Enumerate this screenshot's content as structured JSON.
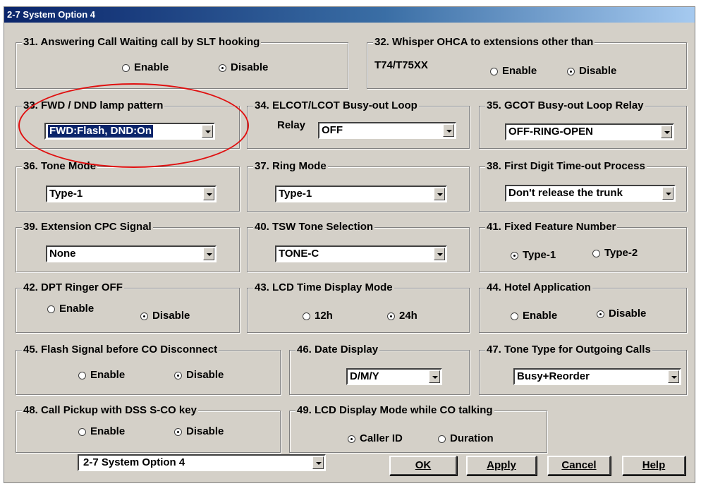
{
  "title": "2-7 System Option 4",
  "g31": {
    "legend": "31. Answering Call Waiting call by SLT hooking",
    "opt1": "Enable",
    "opt2": "Disable"
  },
  "g32": {
    "legend": "32. Whisper OHCA to extensions other than",
    "sub": "T74/T75XX",
    "opt1": "Enable",
    "opt2": "Disable"
  },
  "g33": {
    "legend": "33. FWD / DND lamp pattern",
    "value": "FWD:Flash, DND:On"
  },
  "g34": {
    "legend": "34. ELCOT/LCOT Busy-out Loop",
    "prefix": "Relay",
    "value": "OFF"
  },
  "g35": {
    "legend": "35. GCOT Busy-out Loop Relay",
    "value": "OFF-RING-OPEN"
  },
  "g36": {
    "legend": "36. Tone Mode",
    "value": "Type-1"
  },
  "g37": {
    "legend": "37. Ring Mode",
    "value": "Type-1"
  },
  "g38": {
    "legend": "38. First Digit Time-out Process",
    "value": "Don't release the trunk"
  },
  "g39": {
    "legend": "39. Extension CPC Signal",
    "value": "None"
  },
  "g40": {
    "legend": "40. TSW Tone Selection",
    "value": "TONE-C"
  },
  "g41": {
    "legend": "41. Fixed Feature Number",
    "opt1": "Type-1",
    "opt2": "Type-2"
  },
  "g42": {
    "legend": "42. DPT Ringer OFF",
    "opt1": "Enable",
    "opt2": "Disable"
  },
  "g43": {
    "legend": "43. LCD Time Display Mode",
    "opt1": "12h",
    "opt2": "24h"
  },
  "g44": {
    "legend": "44. Hotel Application",
    "opt1": "Enable",
    "opt2": "Disable"
  },
  "g45": {
    "legend": "45. Flash Signal before CO Disconnect",
    "opt1": "Enable",
    "opt2": "Disable"
  },
  "g46": {
    "legend": "46. Date Display",
    "value": "D/M/Y"
  },
  "g47": {
    "legend": "47. Tone Type for Outgoing Calls",
    "value": "Busy+Reorder"
  },
  "g48": {
    "legend": "48. Call Pickup with DSS S-CO key",
    "opt1": "Enable",
    "opt2": "Disable"
  },
  "g49": {
    "legend": "49. LCD Display Mode while CO talking",
    "opt1": "Caller ID",
    "opt2": "Duration"
  },
  "footer": {
    "page_select": "2-7 System Option 4",
    "ok": "OK",
    "apply": "Apply",
    "cancel": "Cancel",
    "help": "Help"
  },
  "annotation": {
    "color": "#e01010"
  }
}
